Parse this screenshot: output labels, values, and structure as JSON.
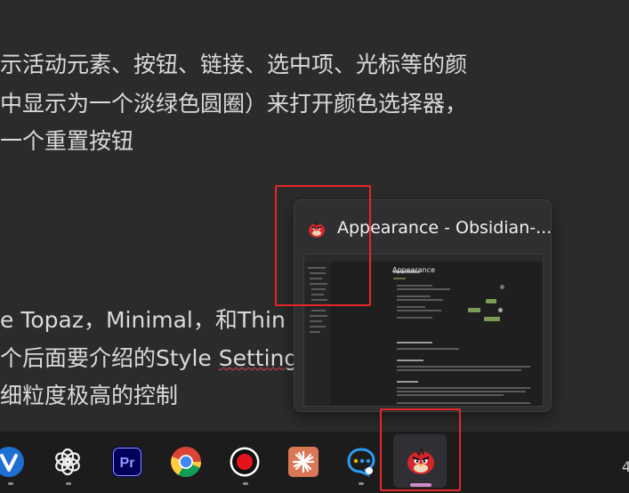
{
  "document": {
    "lines": [
      "示活动元素、按钮、链接、选中项、光标等的颜",
      "中显示为一个淡绿色圆圈）来打开颜色选择器，",
      "一个重置按钮",
      "e Topaz，Minimal，和Thin",
      "个后面要介绍的Style Setting",
      "细粒度极高的控制"
    ]
  },
  "preview": {
    "title": "Appearance - Obsidian-...",
    "thumbnail": {
      "heading": "Appearance",
      "section_items": [
        "1. Base color scheme",
        "2. Accent color",
        "3. Theme"
      ]
    }
  },
  "taskbar": {
    "apps": [
      {
        "name": "vivaldi-browser",
        "label": "V"
      },
      {
        "name": "chatgpt",
        "label": ""
      },
      {
        "name": "premiere-pro",
        "label": "Pr"
      },
      {
        "name": "chrome",
        "label": ""
      },
      {
        "name": "screen-recorder",
        "label": ""
      },
      {
        "name": "claude",
        "label": ""
      },
      {
        "name": "chat-app",
        "label": ""
      },
      {
        "name": "obsidian-angry-bird",
        "label": ""
      }
    ],
    "partial_char": "4"
  },
  "colors": {
    "annotation": "#e8262a",
    "accent_green": "#7a9a55",
    "active_indicator": "#d08cc8"
  }
}
